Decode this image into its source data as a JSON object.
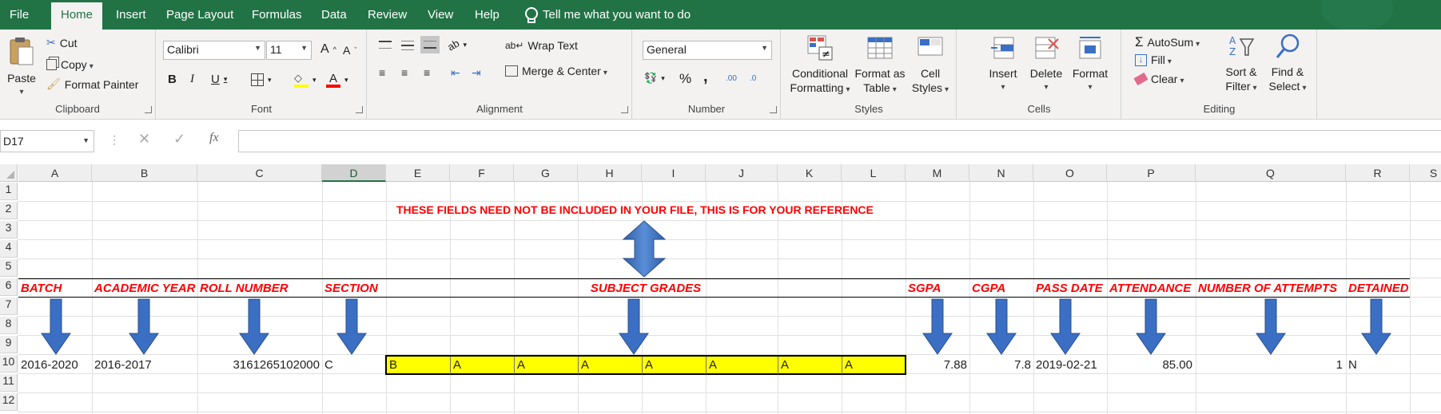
{
  "menu": {
    "items": [
      "File",
      "Home",
      "Insert",
      "Page Layout",
      "Formulas",
      "Data",
      "Review",
      "View",
      "Help"
    ],
    "tell_me": "Tell me what you want to do"
  },
  "ribbon": {
    "clipboard": {
      "paste": "Paste",
      "cut": "Cut",
      "copy": "Copy",
      "format_painter": "Format Painter",
      "label": "Clipboard"
    },
    "font": {
      "name": "Calibri",
      "size": "11",
      "label": "Font",
      "bold": "B",
      "italic": "I",
      "underline": "U",
      "grow": "A",
      "shrink": "A"
    },
    "alignment": {
      "wrap": "Wrap Text",
      "merge": "Merge & Center",
      "label": "Alignment"
    },
    "number": {
      "format": "General",
      "label": "Number",
      "percent": "%",
      "comma": ",",
      "inc_decimal": ".00",
      "dec_decimal": ".0"
    },
    "styles": {
      "conditional": "Conditional",
      "conditional2": "Formatting",
      "format_as": "Format as",
      "format_as2": "Table",
      "cell": "Cell",
      "cell2": "Styles",
      "label": "Styles"
    },
    "cells": {
      "insert": "Insert",
      "delete": "Delete",
      "format": "Format",
      "label": "Cells"
    },
    "editing": {
      "autosum": "AutoSum",
      "fill": "Fill",
      "clear": "Clear",
      "sort": "Sort &",
      "sort2": "Filter",
      "find": "Find &",
      "find2": "Select",
      "label": "Editing"
    }
  },
  "formula_bar": {
    "name_box": "D17",
    "formula": "",
    "fx": "fx"
  },
  "sheet": {
    "columns": [
      "A",
      "B",
      "C",
      "D",
      "E",
      "F",
      "G",
      "H",
      "I",
      "J",
      "K",
      "L",
      "M",
      "N",
      "O",
      "P",
      "Q",
      "R",
      "S"
    ],
    "selected_column": "D",
    "rows": [
      "1",
      "2",
      "3",
      "4",
      "5",
      "6",
      "7",
      "8",
      "9",
      "10",
      "11",
      "12"
    ],
    "note": "THESE FIELDS NEED NOT BE INCLUDED IN YOUR FILE, THIS IS FOR YOUR REFERENCE",
    "headers": {
      "batch": "BATCH",
      "academic_year": "ACADEMIC YEAR",
      "roll_number": "ROLL NUMBER",
      "section": "SECTION",
      "subject_grades": "SUBJECT GRADES",
      "sgpa": "SGPA",
      "cgpa": "CGPA",
      "pass_date": "PASS DATE",
      "attendance": "ATTENDANCE",
      "attempts": "NUMBER OF ATTEMPTS",
      "detained": "DETAINED"
    },
    "row10": {
      "batch": "2016-2020",
      "academic_year": "2016-2017",
      "roll_number": "3161265102000",
      "section": "C",
      "grades": [
        "B",
        "A",
        "A",
        "A",
        "A",
        "A",
        "A",
        "A"
      ],
      "sgpa": "7.88",
      "cgpa": "7.8",
      "pass_date": "2019-02-21",
      "attendance": "85.00",
      "attempts": "1",
      "detained": "N"
    },
    "accent_color": "#217346",
    "header_text_color": "#ff0000",
    "highlight_color": "#ffff00",
    "arrow_color": "#3a6fc4"
  }
}
